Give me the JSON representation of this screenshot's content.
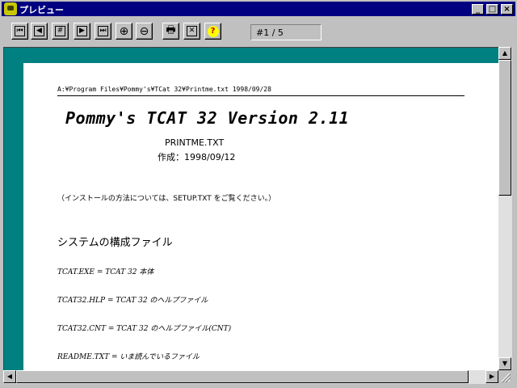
{
  "window": {
    "title": "プレビュー",
    "minimize_label": "_",
    "maximize_label": "□",
    "close_label": "×"
  },
  "toolbar": {
    "page_indicator": "#1 / 5",
    "buttons": [
      {
        "name": "first-page-icon",
        "glyph": "⏮"
      },
      {
        "name": "prev-page-icon",
        "glyph": "◀"
      },
      {
        "name": "goto-page-icon",
        "glyph": "#"
      },
      {
        "name": "next-page-icon",
        "glyph": "▶"
      },
      {
        "name": "last-page-icon",
        "glyph": "⏭"
      },
      {
        "name": "zoom-in-icon",
        "glyph": "⊕"
      },
      {
        "name": "zoom-out-icon",
        "glyph": "⊖"
      },
      {
        "name": "print-icon",
        "glyph": "🖶"
      },
      {
        "name": "close-preview-icon",
        "glyph": "✕"
      },
      {
        "name": "help-icon",
        "glyph": "?"
      }
    ]
  },
  "document": {
    "header_path": "A:¥Program Files¥Pommy's¥TCat 32¥Printme.txt 1998/09/28",
    "title": "Pommy's TCAT 32 Version 2.11",
    "filename": "PRINTME.TXT",
    "created": "作成：1998/09/12",
    "install_note": "（インストールの方法については、SETUP.TXT をご覧ください。）",
    "section_heading": "システムの構成ファイル",
    "files": [
      "TCAT.EXE = TCAT 32 本体",
      "TCAT32.HLP = TCAT 32 のヘルプファイル",
      "TCAT32.CNT = TCAT 32 のヘルプファイル(CNT)",
      "README.TXT = いま読んでいるファイル"
    ]
  },
  "scrollbars": {
    "up_arrow": "▲",
    "down_arrow": "▼",
    "left_arrow": "◀",
    "right_arrow": "▶"
  }
}
